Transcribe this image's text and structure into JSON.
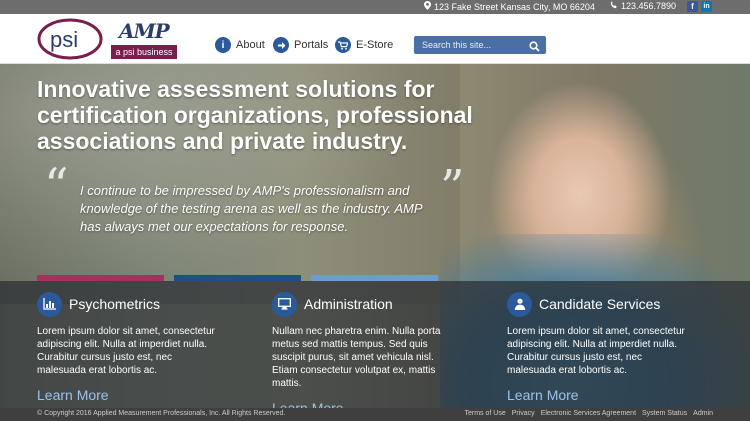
{
  "topbar": {
    "address": "123 Fake Street Kansas City, MO 66204",
    "phone": "123.456.7890",
    "facebook": "f",
    "linkedin": "in"
  },
  "header": {
    "logo_psi": "psi",
    "logo_amp": "AMP",
    "logo_amp_tagline": "a psi business",
    "nav": [
      {
        "label": "About",
        "icon": "info-icon"
      },
      {
        "label": "Portals",
        "icon": "arrow-right-icon"
      },
      {
        "label": "E-Store",
        "icon": "cart-icon"
      }
    ],
    "search_placeholder": "Search this site..."
  },
  "hero": {
    "headline": "Innovative assessment solutions for certification organizations, professional associations and private industry.",
    "quote": "I continue to be impressed by AMP's professionalism and knowledge of the testing arena as well as the industry. AMP has always met our expectations for response."
  },
  "features": [
    {
      "title": "Psychometrics",
      "icon": "bar-chart-icon",
      "text": "Lorem ipsum dolor sit amet, consectetur adipiscing elit. Nulla at imperdiet nulla. Curabitur cursus justo est, nec malesuada erat lobortis ac.",
      "link": "Learn More"
    },
    {
      "title": "Administration",
      "icon": "monitor-icon",
      "text": "Nullam nec pharetra enim. Nulla porta metus sed mattis tempus. Sed quis suscipit purus, sit amet vehicula nisl. Etiam consectetur volutpat ex, mattis mattis.",
      "link": "Learn More"
    },
    {
      "title": "Candidate Services",
      "icon": "user-icon",
      "text": "Lorem ipsum dolor sit amet, consectetur adipiscing elit. Nulla at imperdiet nulla. Curabitur cursus justo est, nec malesuada erat lobortis ac.",
      "link": "Learn More"
    }
  ],
  "footer": {
    "copyright": "© Copyright 2016 Applied Measurement Professionals, Inc. All Rights Reserved.",
    "links": [
      "Terms of Use",
      "Privacy",
      "Electronic Services Agreement",
      "System Status",
      "Admin"
    ]
  },
  "colors": {
    "brand_blue": "#2a5a9b",
    "brand_maroon": "#7a1e4b",
    "accent_pink": "#a6315f",
    "link_blue": "#9bc2ec"
  }
}
